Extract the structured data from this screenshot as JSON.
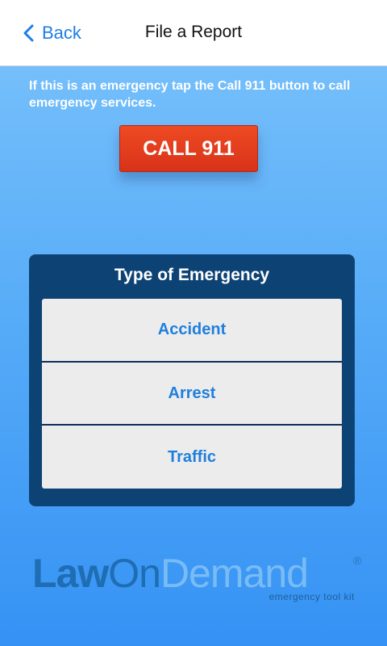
{
  "navbar": {
    "back_label": "Back",
    "title": "File a Report"
  },
  "instructions": "If this is an emergency tap the Call 911 button to call emergency services.",
  "call_button": {
    "label": "CALL 911",
    "color": "#e13d1e"
  },
  "emergency_panel": {
    "title": "Type of Emergency",
    "options": [
      {
        "label": "Accident"
      },
      {
        "label": "Arrest"
      },
      {
        "label": "Traffic"
      }
    ]
  },
  "logo": {
    "law": "Law",
    "on": "On",
    "demand": "Demand",
    "registered": "®",
    "tagline": "emergency tool kit"
  },
  "colors": {
    "accent": "#1e7ee6",
    "panel": "#0d4374",
    "background_top": "#7cc3fb",
    "background_bottom": "#3592f4"
  },
  "icons": {
    "back": "chevron-left-icon"
  }
}
